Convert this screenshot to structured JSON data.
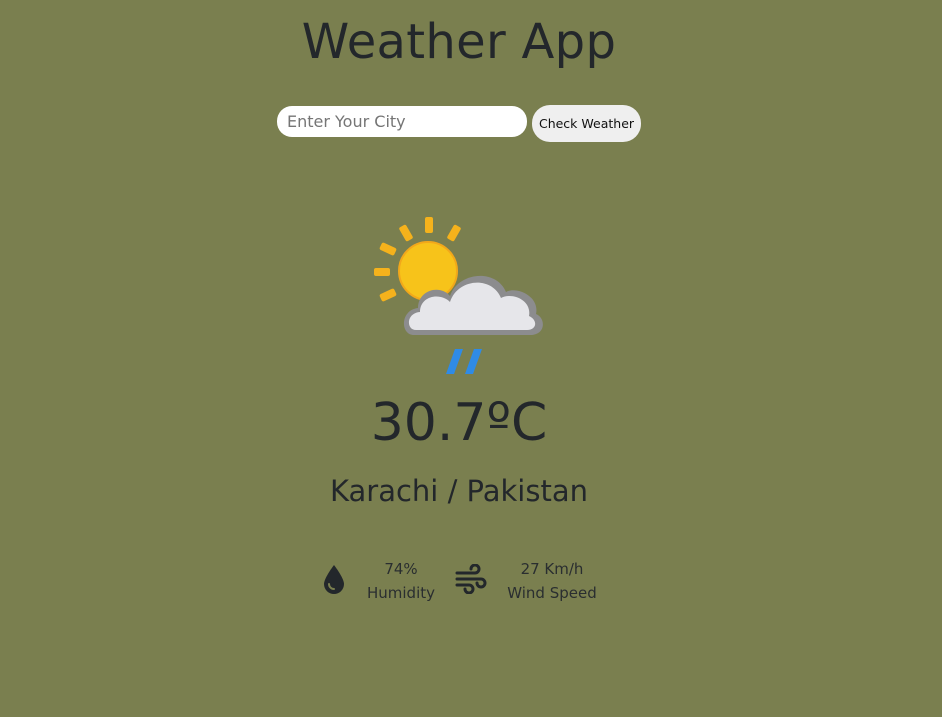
{
  "header": {
    "title": "Weather App"
  },
  "search": {
    "placeholder": "Enter Your City",
    "value": "",
    "button_label": "Check Weather"
  },
  "weather": {
    "icon": "sun-behind-rain-cloud-icon",
    "temperature": "30.7ºC",
    "location": "Karachi / Pakistan"
  },
  "stats": {
    "humidity": {
      "icon": "water-drop-icon",
      "value": "74%",
      "label": "Humidity"
    },
    "wind": {
      "icon": "wind-icon",
      "value": "27 Km/h",
      "label": "Wind Speed"
    }
  },
  "colors": {
    "background": "#7a7f4f",
    "text": "#23272b",
    "sun": "#f7c31a",
    "sun_rays": "#f5b21c",
    "cloud": "#e6e6ea",
    "cloud_outline": "#8c8c8e",
    "rain": "#2f8be6"
  }
}
